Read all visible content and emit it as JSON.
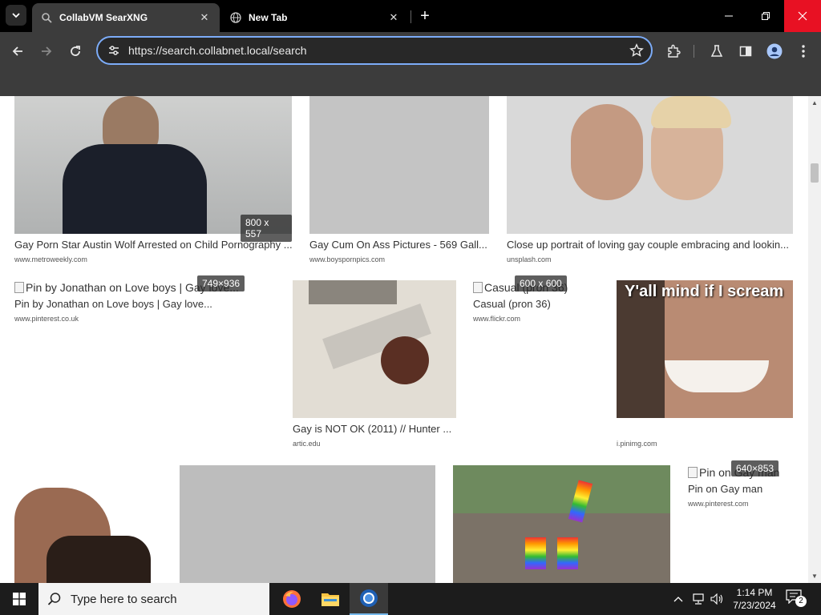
{
  "browser": {
    "tabs": [
      {
        "title": "CollabVM SearXNG",
        "active": true
      },
      {
        "title": "New Tab",
        "active": false
      }
    ],
    "close_glyph": "✕",
    "newtab_glyph": "+",
    "url": "https://search.collabnet.local/search",
    "accent_color": "#7cacf8"
  },
  "results": [
    {
      "title": "Gay Porn Star Austin Wolf Arrested on Child Pornography ...",
      "url": "www.metroweekly.com",
      "dim": "800 x 557",
      "image": "man-in-dark-shirt-photo"
    },
    {
      "title": "Gay Cum On Ass Pictures - 569 Gall...",
      "url": "www.boyspornpics.com",
      "image": "explicit-photo"
    },
    {
      "title": "Close up portrait of loving gay couple embracing and lookin...",
      "url": "unsplash.com",
      "image": "couple-portrait-photo"
    },
    {
      "title": "Pin by Jonathan on Love boys | Gay love...",
      "url": "www.pinterest.co.uk",
      "alt": "Pin by Jonathan on Love boys | Gay love...",
      "dim": "749×936",
      "image": "broken-image"
    },
    {
      "title": "Gay is NOT OK (2011) // Hunter ...",
      "url": "artic.edu",
      "image": "collage-artwork"
    },
    {
      "title": "Casual (pron 36)",
      "url": "www.flickr.com",
      "alt": "Casual (pron 36)",
      "dim": "600 x 600",
      "image": "broken-image"
    },
    {
      "title": "",
      "url": "i.pinimg.com",
      "meme_text": "Y'all mind if I scream",
      "image": "meme-face-closeup"
    },
    {
      "title": "Pin on Gay man",
      "url": "www.pinterest.com",
      "alt": "Pin on Gay man",
      "dim": "640×853",
      "image": "broken-image"
    },
    {
      "title": "",
      "url": "",
      "image": "bearded-man-photo"
    },
    {
      "title": "",
      "url": "",
      "image": "explicit-photo"
    },
    {
      "title": "",
      "url": "",
      "image": "pride-parade-photo"
    }
  ],
  "taskbar": {
    "search_placeholder": "Type here to search",
    "time": "1:14 PM",
    "date": "7/23/2024",
    "notification_count": "2",
    "apps": [
      "firefox-icon",
      "file-explorer-icon",
      "chrome-icon"
    ]
  }
}
